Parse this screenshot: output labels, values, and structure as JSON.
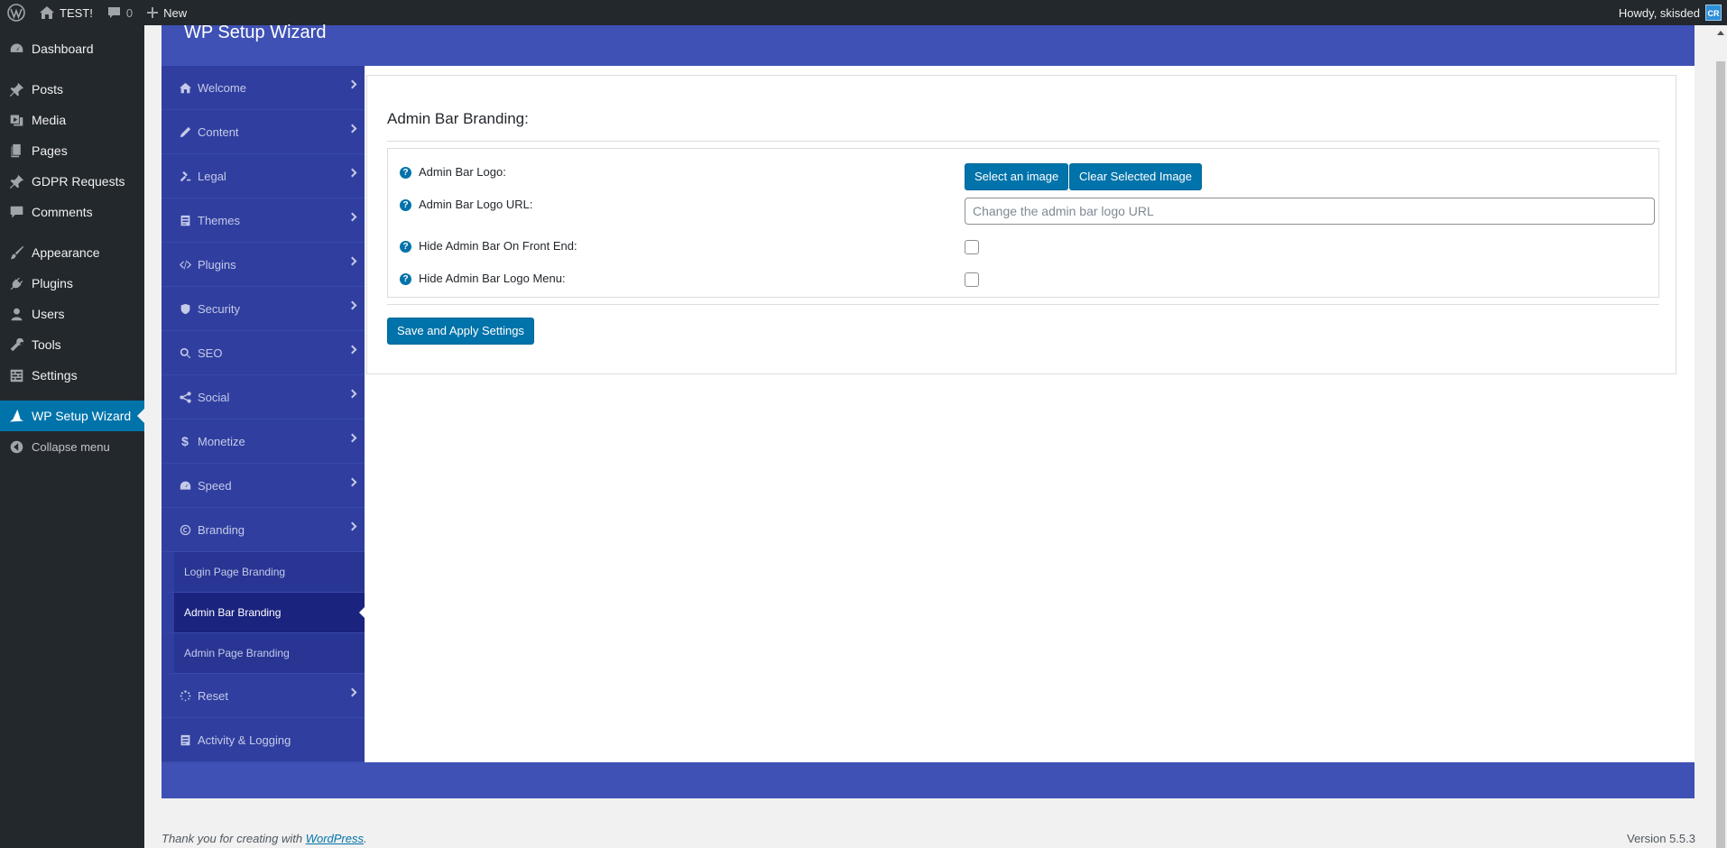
{
  "adminbar": {
    "site_name": "TEST!",
    "comments_count": "0",
    "new_label": "New",
    "howdy": "Howdy, skisded",
    "avatar_text": "CR"
  },
  "adminmenu": {
    "items": [
      {
        "label": "Dashboard",
        "icon": "dashboard-icon"
      },
      {
        "label": "Posts",
        "icon": "pin-icon"
      },
      {
        "label": "Media",
        "icon": "media-icon"
      },
      {
        "label": "Pages",
        "icon": "pages-icon"
      },
      {
        "label": "GDPR Requests",
        "icon": "pin-icon"
      },
      {
        "label": "Comments",
        "icon": "comment-icon"
      },
      {
        "label": "Appearance",
        "icon": "brush-icon"
      },
      {
        "label": "Plugins",
        "icon": "plugin-icon"
      },
      {
        "label": "Users",
        "icon": "user-icon"
      },
      {
        "label": "Tools",
        "icon": "wrench-icon"
      },
      {
        "label": "Settings",
        "icon": "settings-icon"
      },
      {
        "label": "WP Setup Wizard",
        "icon": "wizard-hat-icon"
      },
      {
        "label": "Collapse menu",
        "icon": "collapse-icon"
      }
    ]
  },
  "wizard": {
    "title": "WP Setup Wizard",
    "nav": [
      {
        "label": "Welcome",
        "icon": "home-icon"
      },
      {
        "label": "Content",
        "icon": "pencil-icon"
      },
      {
        "label": "Legal",
        "icon": "gavel-icon"
      },
      {
        "label": "Themes",
        "icon": "document-icon"
      },
      {
        "label": "Plugins",
        "icon": "code-icon"
      },
      {
        "label": "Security",
        "icon": "shield-icon"
      },
      {
        "label": "SEO",
        "icon": "search-icon"
      },
      {
        "label": "Social",
        "icon": "share-icon"
      },
      {
        "label": "Monetize",
        "icon": "dollar-icon"
      },
      {
        "label": "Speed",
        "icon": "speedometer-icon"
      },
      {
        "label": "Branding",
        "icon": "copyright-icon"
      }
    ],
    "branding_sub": [
      {
        "label": "Login Page Branding"
      },
      {
        "label": "Admin Bar Branding"
      },
      {
        "label": "Admin Page Branding"
      }
    ],
    "nav_after": [
      {
        "label": "Reset",
        "icon": "spinner-icon"
      },
      {
        "label": "Activity & Logging",
        "icon": "log-icon"
      }
    ]
  },
  "panel": {
    "title": "Admin Bar Branding:",
    "fields": {
      "logo_label": "Admin Bar Logo:",
      "select_image_label": "Select an image",
      "clear_image_label": "Clear Selected Image",
      "logo_url_label": "Admin Bar Logo URL:",
      "logo_url_placeholder": "Change the admin bar logo URL",
      "logo_url_value": "",
      "hide_front_label": "Hide Admin Bar On Front End:",
      "hide_front_checked": false,
      "hide_menu_label": "Hide Admin Bar Logo Menu:",
      "hide_menu_checked": false
    },
    "save_label": "Save and Apply Settings"
  },
  "footer": {
    "thanks_prefix": "Thank you for creating with ",
    "wordpress_link": "WordPress",
    "thanks_suffix": ".",
    "version": "Version 5.5.3"
  },
  "colors": {
    "wizard_header": "#3f51b5",
    "wizard_nav": "#303f9f",
    "wp_blue": "#0073aa",
    "admin_dark": "#23282d"
  }
}
